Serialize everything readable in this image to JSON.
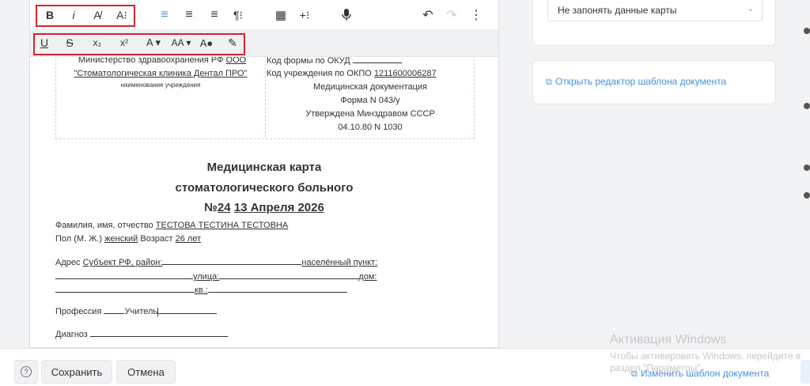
{
  "toolbar": {
    "row1": [
      {
        "name": "bold-button",
        "glyph": "B"
      },
      {
        "name": "italic-button",
        "glyph": "i"
      },
      {
        "name": "clear-format-button",
        "glyph": "A̸"
      },
      {
        "name": "font-size-button",
        "glyph": "A⁝"
      },
      {
        "name": "align-left-button",
        "glyph": "≡"
      },
      {
        "name": "align-center-button",
        "glyph": "≡"
      },
      {
        "name": "align-right-button",
        "glyph": "≡"
      },
      {
        "name": "paragraph-button",
        "glyph": "¶⁝"
      },
      {
        "name": "table-button",
        "glyph": "▦"
      },
      {
        "name": "insert-button",
        "glyph": "+⁝"
      },
      {
        "name": "microphone-button",
        "glyph": "🎙"
      },
      {
        "name": "undo-button",
        "glyph": "↶"
      },
      {
        "name": "redo-button",
        "glyph": "↷"
      },
      {
        "name": "more-button",
        "glyph": "⋮"
      }
    ],
    "row2": [
      {
        "name": "underline-button",
        "glyph": "U"
      },
      {
        "name": "strikethrough-button",
        "glyph": "S"
      },
      {
        "name": "subscript-button",
        "glyph": "x₂"
      },
      {
        "name": "superscript-button",
        "glyph": "x²"
      },
      {
        "name": "font-family-button",
        "glyph": "A ▾"
      },
      {
        "name": "text-case-button",
        "glyph": "AA ▾"
      },
      {
        "name": "text-color-button",
        "glyph": "A●"
      },
      {
        "name": "highlight-button",
        "glyph": "✎"
      }
    ]
  },
  "document": {
    "header_left": {
      "org_prefix": "Министерство здравоохранения РФ",
      "org_suffix": "ООО",
      "clinic": "\"Стоматологическая клиника Дентал ПРО\"",
      "caption": "наименование учреждения"
    },
    "header_right": {
      "okud_label": "Код формы по ОКУД",
      "okpo_label": "Код учреждения по ОКПО",
      "okpo_value": "1211600006287",
      "line3": "Медицинская документация",
      "line4": "Форма N 043/у",
      "line5": "Утверждена Минздравом СССР",
      "line6": "04.10.80 N 1030"
    },
    "title_line1": "Медицинская карта",
    "title_line2": "стоматологического больного",
    "title_no_prefix": "№",
    "title_no": "24",
    "title_date": "13 Апреля 2026",
    "fio_label": "Фамилия, имя, отчество",
    "fio_value": "ТЕСТОВА ТЕСТИНА ТЕСТОВНА",
    "sex_label": "Пол (М. Ж.)",
    "sex_value": "женский",
    "age_label": "Возраст",
    "age_value": "26 лет",
    "address_label": "Адрес",
    "address_subject": "Субъект РФ, район:",
    "settlement_label": "населённый пункт:",
    "street_label": "улица:",
    "house_label": "дом:",
    "apt_label": "кв.:",
    "profession_label": "Профессия",
    "profession_value": "Учитель",
    "diagnosis_label": "Диагноз"
  },
  "right_panel": {
    "select_value": "Не запонять данные карты",
    "open_editor_link": "Открыть редактор шаблона документа"
  },
  "footer": {
    "help_label": "?",
    "save_label": "Сохранить",
    "cancel_label": "Отмена",
    "change_template_link": "Изменить шаблон документа"
  },
  "watermark": {
    "title": "Активация Windows",
    "line2": "Чтобы активировать Windows, перейдите в",
    "line3": "раздел \"Параметры\"."
  }
}
